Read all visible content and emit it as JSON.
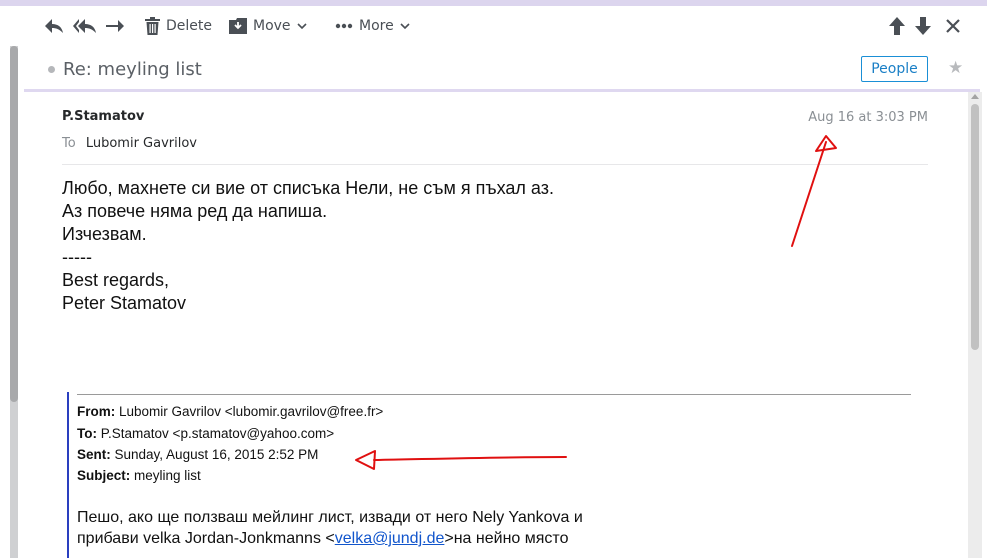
{
  "toolbar": {
    "back_icon": "arrow-left-icon",
    "reply_all_icon": "reply-all-icon",
    "forward_icon": "arrow-right-icon",
    "delete_label": "Delete",
    "move_label": "Move",
    "more_label": "More",
    "prev_icon": "arrow-up-icon",
    "next_icon": "arrow-down-icon",
    "close_icon": "close-icon"
  },
  "subject": "Re: meyling list",
  "people_label": "People",
  "message": {
    "sender": "P.Stamatov",
    "to_label": "To",
    "to_name": "Lubomir Gavrilov",
    "date": "Aug 16 at 3:03 PM",
    "body_lines": [
      "Любо, махнете си вие от списъка Нели, не съм я пъхал аз.",
      "Аз повече няма ред да напиша.",
      "Изчезвам.",
      "-----",
      "Best regards,",
      "Peter Stamatov"
    ]
  },
  "quoted": {
    "from_label": "From:",
    "from_value": "Lubomir Gavrilov <lubomir.gavrilov@free.fr>",
    "to_label": "To:",
    "to_value": "P.Stamatov <p.stamatov@yahoo.com>",
    "sent_label": "Sent:",
    "sent_value": "Sunday, August 16, 2015 2:52 PM",
    "subject_label": "Subject:",
    "subject_value": "meyling list",
    "body_line1": "Пешо, ако ще ползваш  мейлинг лист, извади от него  Nely Yankova  и",
    "body_line2_pre": "прибави velka Jordan-Jonkmanns <",
    "body_link": "velka@jundj.de",
    "body_line2_post": ">на нейно място"
  },
  "colors": {
    "accent": "#1a8fd6",
    "annotation_red": "#e01010",
    "quote_border": "#2a3fbf"
  }
}
